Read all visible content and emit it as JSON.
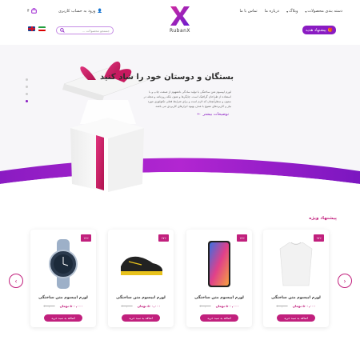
{
  "header": {
    "nav": [
      "دسته بندی محصولات",
      "وبلاگ",
      "درباره ما",
      "تماس با ما"
    ],
    "logo_text": "RubanX",
    "login_label": "ورود به حساب کاربری",
    "cart_count": "۴",
    "offer_button": "پیشنهاد هدیه",
    "search_placeholder": "جستجو محصولات ..."
  },
  "hero": {
    "title": "بستگان و دوستان خود را شاد کنید",
    "description": "لورم ایپسوم متن ساختگی با تولید سادگی نامفهوم از صنعت چاپ و با استفاده از طراحان گرافیک است. چاپگرها و متون بلکه روزنامه و مجله در ستون و سطرآنچنان که لازم است و برای شرایط فعلی تکنولوژی مورد نیاز و کاربردهای متنوع با هدف بهبود ابزارهای کاربردی می باشد.",
    "more_label": "توضیحات بیشتر"
  },
  "section": {
    "title": "پیشنهاد ویژه"
  },
  "products": [
    {
      "name": "لورم ایپسوم متن ساختگی",
      "price_new": "۵۰۰,۰۰۰ تومان",
      "price_old": "۶۰۰,۰۰۰",
      "discount": "۱۷٪",
      "button": "اضافه به سبد خرید",
      "image": "shirt"
    },
    {
      "name": "لورم ایپسوم متن ساختگی",
      "price_new": "۵۰۰,۰۰۰ تومان",
      "price_old": "۶۰۰,۰۰۰",
      "discount": "۱۷٪",
      "button": "اضافه به سبد خرید",
      "image": "phone"
    },
    {
      "name": "لورم ایپسوم متن ساختگی",
      "price_new": "۵۰۰,۰۰۰ تومان",
      "price_old": "۶۰۰,۰۰۰",
      "discount": "۱۷٪",
      "button": "اضافه به سبد خرید",
      "image": "shoe"
    },
    {
      "name": "لورم ایپسوم متن ساختگی",
      "price_new": "۵۰۰,۰۰۰ تومان",
      "price_old": "۶۰۰,۰۰۰",
      "discount": "۱۷٪",
      "button": "اضافه به سبد خرید",
      "image": "watch"
    }
  ],
  "colors": {
    "brand": "#8a1bc2",
    "accent": "#c1207d"
  }
}
